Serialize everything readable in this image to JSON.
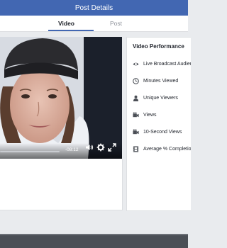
{
  "header": {
    "title": "Post Details"
  },
  "tabs": [
    {
      "label": "Video",
      "active": true
    },
    {
      "label": "Post",
      "active": false
    }
  ],
  "player": {
    "time_remaining": "-08:12"
  },
  "panel": {
    "title": "Video Performance",
    "metrics": [
      {
        "label": "Live Broadcast Audience",
        "icon": "eye-icon"
      },
      {
        "label": "Minutes Viewed",
        "icon": "clock-icon"
      },
      {
        "label": "Unique Viewers",
        "icon": "person-icon"
      },
      {
        "label": "Views",
        "icon": "camera-icon"
      },
      {
        "label": "10-Second Views",
        "icon": "camera-icon"
      },
      {
        "label": "Average % Completion",
        "icon": "film-icon"
      }
    ]
  },
  "colors": {
    "brand": "#4267b2",
    "background": "#e9ebee",
    "text": "#1d2129",
    "muted": "#90949c"
  }
}
